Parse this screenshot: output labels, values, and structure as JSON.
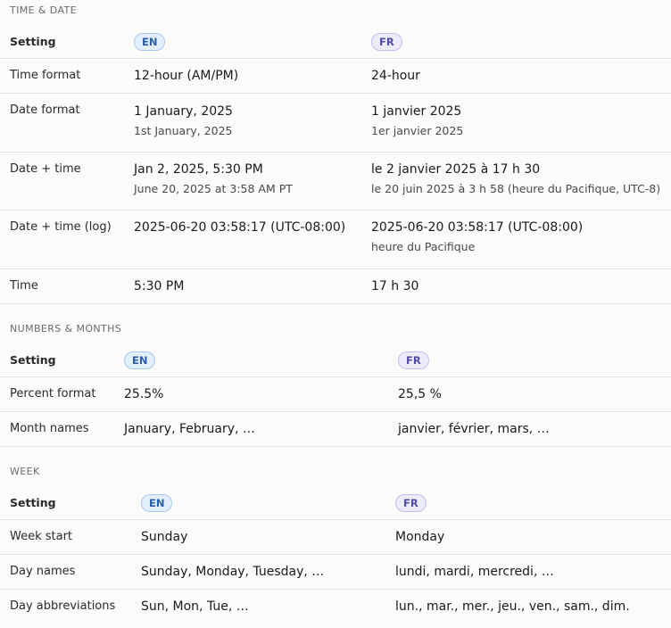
{
  "time_date": {
    "title": "TIME & DATE",
    "header": {
      "label": "Setting",
      "en": "EN",
      "fr": "FR"
    },
    "rows": [
      {
        "label": "Time format",
        "en": [
          "12-hour (AM/PM)"
        ],
        "fr": [
          "24-hour"
        ]
      },
      {
        "label": "Date format",
        "en": [
          "1 January, 2025",
          "1st January, 2025"
        ],
        "fr": [
          "1 janvier 2025",
          "1er janvier 2025"
        ]
      },
      {
        "label": "Date + time",
        "en": [
          "Jan 2, 2025, 5:30 PM",
          "June 20, 2025 at 3:58 AM PT"
        ],
        "fr": [
          "le 2 janvier 2025 à 17 h 30",
          "le 20 juin 2025 à 3 h 58 (heure du Pacifique, UTC-8)"
        ]
      },
      {
        "label": "Date + time (log)",
        "en": [
          "2025-06-20 03:58:17 (UTC-08:00)"
        ],
        "fr": [
          "2025-06-20 03:58:17 (UTC-08:00)",
          "heure du Pacifique"
        ]
      },
      {
        "label": "Time",
        "en": [
          "5:30 PM"
        ],
        "fr": [
          "17 h 30"
        ]
      }
    ]
  },
  "numbers_months": {
    "title": "NUMBERS & MONTHS",
    "header": {
      "label": "Setting",
      "en": "EN",
      "fr": "FR"
    },
    "rows": [
      {
        "label": "Percent format",
        "en": [
          "25.5%"
        ],
        "fr": [
          "25,5 %"
        ]
      },
      {
        "label": "Month names",
        "en": [
          "January, February, …"
        ],
        "fr": [
          "janvier, février, mars, …"
        ]
      }
    ]
  },
  "week": {
    "title": "WEEK",
    "header": {
      "label": "Setting",
      "en": "EN",
      "fr": "FR"
    },
    "rows": [
      {
        "label": "Week start",
        "en": [
          "Sunday"
        ],
        "fr": [
          "Monday"
        ]
      },
      {
        "label": "Day names",
        "en": [
          "Sunday, Monday, Tuesday, …"
        ],
        "fr": [
          "lundi, mardi, mercredi, …"
        ]
      },
      {
        "label": "Day abbreviations",
        "en": [
          "Sun, Mon, Tue, …"
        ],
        "fr": [
          "lun., mar., mer., jeu., ven., sam., dim."
        ]
      }
    ]
  }
}
